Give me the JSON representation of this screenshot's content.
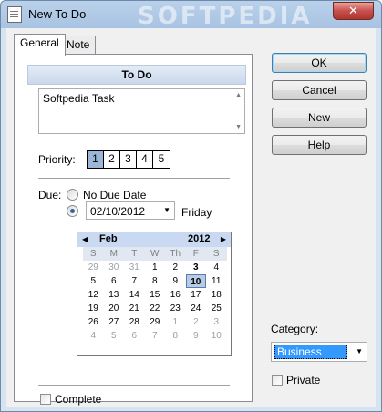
{
  "window": {
    "title": "New To Do",
    "watermark": "SOFTPEDIA",
    "close_glyph": "✕"
  },
  "tabs": [
    {
      "label": "General",
      "active": true
    },
    {
      "label": "Note",
      "active": false
    }
  ],
  "general": {
    "header": "To Do",
    "task_text": "Softpedia Task",
    "priority": {
      "label": "Priority:",
      "options": [
        "1",
        "2",
        "3",
        "4",
        "5"
      ],
      "selected": "1"
    },
    "due": {
      "label": "Due:",
      "no_due_date_label": "No Due Date",
      "date_value": "02/10/2012",
      "weekday": "Friday",
      "selected_option": "date"
    },
    "calendar": {
      "month": "Feb",
      "year": "2012",
      "weekdays": [
        "S",
        "M",
        "T",
        "W",
        "Th",
        "F",
        "S"
      ],
      "weeks": [
        [
          "29",
          "30",
          "31",
          "1",
          "2",
          "3",
          "4"
        ],
        [
          "5",
          "6",
          "7",
          "8",
          "9",
          "10",
          "11"
        ],
        [
          "12",
          "13",
          "14",
          "15",
          "16",
          "17",
          "18"
        ],
        [
          "19",
          "20",
          "21",
          "22",
          "23",
          "24",
          "25"
        ],
        [
          "26",
          "27",
          "28",
          "29",
          "1",
          "2",
          "3"
        ],
        [
          "4",
          "5",
          "6",
          "7",
          "8",
          "9",
          "10"
        ]
      ],
      "selected_day": "10",
      "bold_day": "3"
    },
    "complete_label": "Complete"
  },
  "buttons": {
    "ok": "OK",
    "cancel": "Cancel",
    "new": "New",
    "help": "Help"
  },
  "category": {
    "label": "Category:",
    "value": "Business",
    "private_label": "Private"
  },
  "colors": {
    "selection": "#3399ff",
    "calendar_header": "#c8d9f1",
    "close_button": "#c75050"
  }
}
